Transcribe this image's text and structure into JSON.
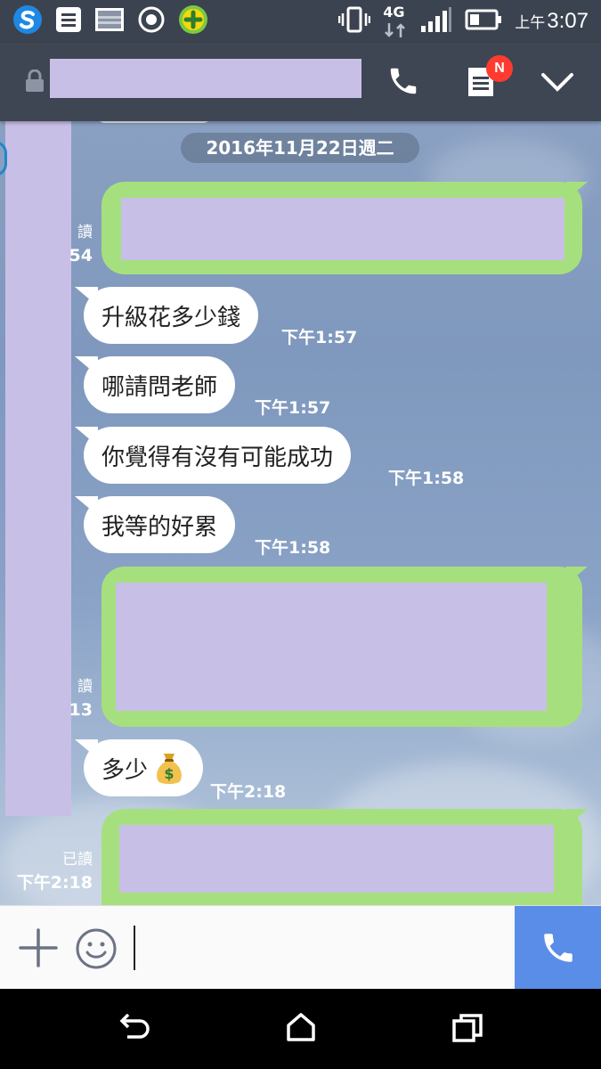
{
  "status_bar": {
    "network": "4G",
    "time_prefix": "上午",
    "time": "3:07"
  },
  "header": {
    "notification_badge": "N"
  },
  "chat": {
    "date_divider": "2016年11月22日週二",
    "messages": [
      {
        "side": "right",
        "read_label": "已讀",
        "time": "下午1:54",
        "read_visible": "讀",
        "time_visible": "54"
      },
      {
        "side": "left",
        "text": "升級花多少錢",
        "time": "下午1:57"
      },
      {
        "side": "left",
        "text": "哪請問老師",
        "time": "下午1:57"
      },
      {
        "side": "left",
        "text": "你覺得有沒有可能成功",
        "time": "下午1:58"
      },
      {
        "side": "left",
        "text": "我等的好累",
        "time": "下午1:58"
      },
      {
        "side": "right",
        "read_visible": "讀",
        "time_visible": "13"
      },
      {
        "side": "left",
        "text": "多少",
        "emoji": "money-bag",
        "time": "下午2:18"
      },
      {
        "side": "right",
        "read_label": "已讀",
        "time": "下午2:18"
      }
    ]
  },
  "colors": {
    "sent_bubble": "#a6e07e",
    "received_bubble": "#ffffff",
    "redaction": "#c8bfe7",
    "header_bg": "#3e4553",
    "call_button": "#5a8de8"
  }
}
